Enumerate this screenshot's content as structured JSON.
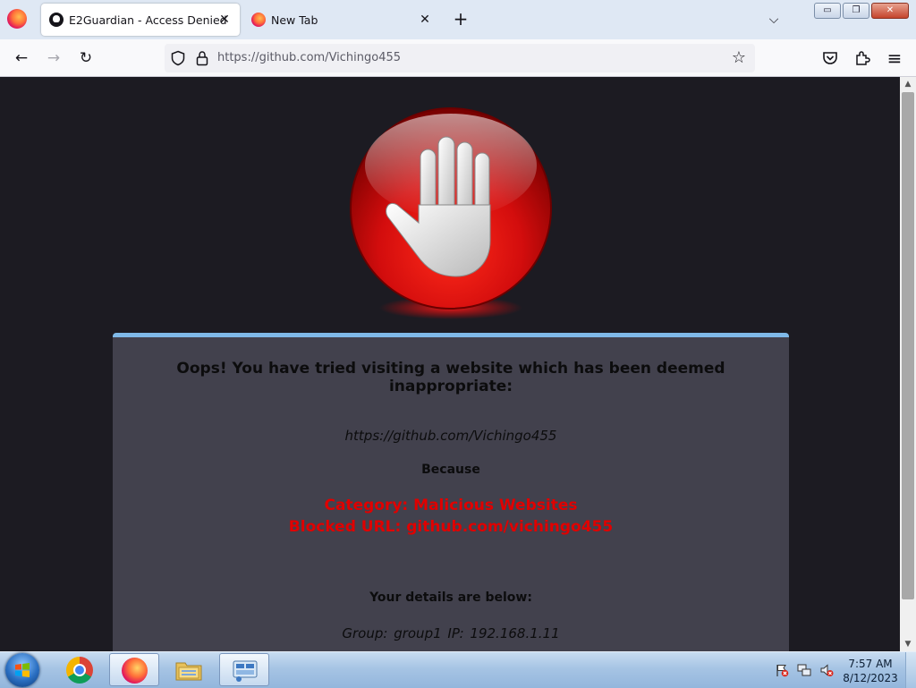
{
  "browser": {
    "tabs": [
      {
        "label": "E2Guardian - Access Denied",
        "favicon": "github-icon",
        "active": true
      },
      {
        "label": "New Tab",
        "favicon": "firefox-icon",
        "active": false
      }
    ],
    "new_tab_symbol": "+",
    "list_tabs_symbol": "⌵",
    "window_buttons": {
      "minimize": "▭",
      "maximize": "❐",
      "close": "✕"
    },
    "url": "https://github.com/Vichingo455",
    "icons": {
      "back": "←",
      "forward": "→",
      "reload": "↻",
      "star": "☆",
      "pocket": "pocket-icon",
      "extensions": "puzzle-icon",
      "menu": "≡"
    }
  },
  "page": {
    "headline": "Oops! You have tried visiting a website which has been deemed inappropriate:",
    "blocked_url": "https://github.com/Vichingo455",
    "because": "Because",
    "reason_category": "Category: Malicious Websites",
    "reason_blocked_url": "Blocked URL: github.com/vichingo455",
    "details_title": "Your details are below:",
    "details": "Group: group1   IP: 192.168.1.11",
    "colors": {
      "panel_bg": "#42414d",
      "panel_border": "#7fb9e8",
      "reason": "#e00000",
      "page_bg": "#1c1b22"
    }
  },
  "taskbar": {
    "pinned": [
      "chrome-icon",
      "firefox-icon",
      "file-explorer-icon",
      "network-tool-icon"
    ],
    "tray": [
      "action-center-flag-icon",
      "network-icon",
      "volume-muted-icon"
    ],
    "time": "7:57 AM",
    "date": "8/12/2023"
  }
}
